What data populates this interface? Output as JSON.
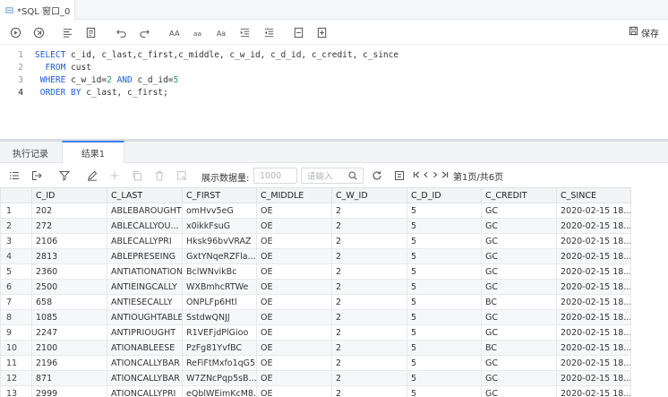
{
  "tab": {
    "title": "*SQL 窗口_0"
  },
  "toolbar": {
    "save_label": "保存"
  },
  "editor": {
    "lines": [
      {
        "n": "1",
        "text": "SELECT c_id, c_last,c_first,c_middle, c_w_id, c_d_id, c_credit, c_since"
      },
      {
        "n": "2",
        "text": "  FROM cust"
      },
      {
        "n": "3",
        "text": " WHERE c_w_id=2 AND c_d_id=5"
      },
      {
        "n": "4",
        "text": " ORDER BY c_last, c_first;"
      }
    ]
  },
  "result_tabs": {
    "history": "执行记录",
    "result": "结果1"
  },
  "result_toolbar": {
    "show_rows_label": "展示数据量:",
    "rows_placeholder": "1000",
    "search_placeholder": "请输入",
    "page_info": "第1页/共6页"
  },
  "grid": {
    "columns": [
      "C_ID",
      "C_LAST",
      "C_FIRST",
      "C_MIDDLE",
      "C_W_ID",
      "C_D_ID",
      "C_CREDIT",
      "C_SINCE"
    ],
    "rows": [
      [
        "1",
        "202",
        "ABLEBAROUGHT",
        "omHvv5eG",
        "OE",
        "2",
        "5",
        "GC",
        "2020-02-15 18..."
      ],
      [
        "2",
        "272",
        "ABLECALLYOU...",
        "x0ikkFsuG",
        "OE",
        "2",
        "5",
        "GC",
        "2020-02-15 18..."
      ],
      [
        "3",
        "2106",
        "ABLECALLYPRI",
        "Hksk96bvVRAZ",
        "OE",
        "2",
        "5",
        "GC",
        "2020-02-15 18..."
      ],
      [
        "4",
        "2813",
        "ABLEPRESEING",
        "GxtYNqeRZFla...",
        "OE",
        "2",
        "5",
        "GC",
        "2020-02-15 18..."
      ],
      [
        "5",
        "2360",
        "ANTIATIONATION",
        "BclWNvikBc",
        "OE",
        "2",
        "5",
        "GC",
        "2020-02-15 18..."
      ],
      [
        "6",
        "2500",
        "ANTIEINGCALLY",
        "WXBmhcRTWe",
        "OE",
        "2",
        "5",
        "GC",
        "2020-02-15 18..."
      ],
      [
        "7",
        "658",
        "ANTIESECALLY",
        "ONPLFp6Htl",
        "OE",
        "2",
        "5",
        "BC",
        "2020-02-15 18..."
      ],
      [
        "8",
        "1085",
        "ANTIOUGHTABLE",
        "SstdwQNJJ",
        "OE",
        "2",
        "5",
        "GC",
        "2020-02-15 18..."
      ],
      [
        "9",
        "2247",
        "ANTIPRIOUGHT",
        "R1VEFjdPlGioo",
        "OE",
        "2",
        "5",
        "GC",
        "2020-02-15 18..."
      ],
      [
        "10",
        "2100",
        "ATIONABLEESE",
        "PzFg81YvfBC",
        "OE",
        "2",
        "5",
        "BC",
        "2020-02-15 18..."
      ],
      [
        "11",
        "2196",
        "ATIONCALLYBAR",
        "ReFiFtMxfo1qG5",
        "OE",
        "2",
        "5",
        "GC",
        "2020-02-15 18..."
      ],
      [
        "12",
        "871",
        "ATIONCALLYBAR",
        "W7ZNcPqp5sB...",
        "OE",
        "2",
        "5",
        "GC",
        "2020-02-15 18..."
      ],
      [
        "13",
        "2999",
        "ATIONCALLYPRI",
        "eQblWEimKcM8...",
        "OE",
        "2",
        "5",
        "GC",
        "2020-02-15 18..."
      ]
    ]
  }
}
